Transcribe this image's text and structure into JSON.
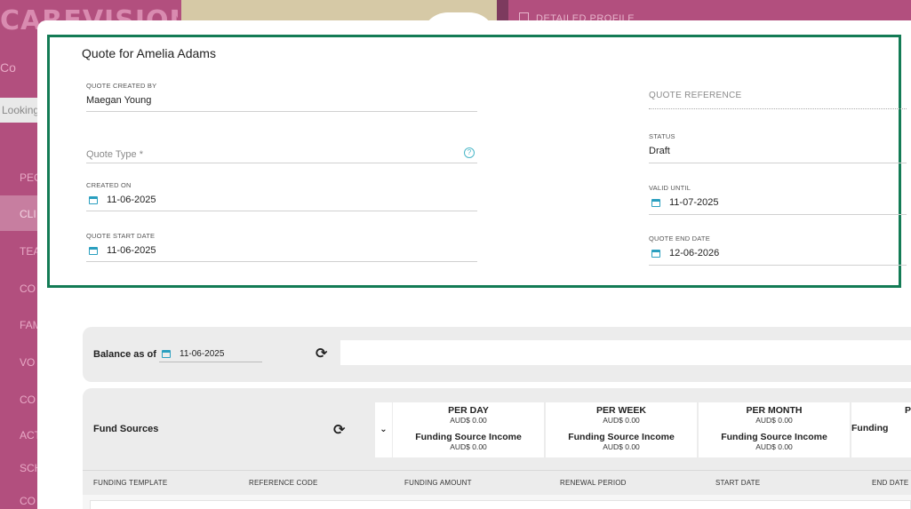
{
  "background": {
    "logo": "CAREVISION",
    "profile_tab": "DETAILED PROFILE",
    "search_placeholder": "Looking",
    "nav_items": [
      "Co",
      "PEO",
      "CLI",
      "TEA",
      "CO",
      "FAM",
      "VO",
      "CO",
      "ACT",
      "SCH",
      "CO"
    ]
  },
  "quote": {
    "title": "Quote for Amelia Adams",
    "created_by_label": "QUOTE CREATED BY",
    "created_by_value": "Maegan Young",
    "quote_type_placeholder": "Quote Type *",
    "created_on_label": "CREATED ON",
    "created_on_value": "11-06-2025",
    "start_date_label": "QUOTE START DATE",
    "start_date_value": "11-06-2025",
    "reference_placeholder": "QUOTE REFERENCE",
    "status_label": "STATUS",
    "status_value": "Draft",
    "valid_until_label": "VALID UNTIL",
    "valid_until_value": "11-07-2025",
    "end_date_label": "QUOTE END DATE",
    "end_date_value": "12-06-2026"
  },
  "balance": {
    "label": "Balance as of",
    "date": "11-06-2025"
  },
  "fund_sources": {
    "title": "Fund Sources",
    "periods": [
      {
        "heading": "PER DAY",
        "value": "AUD$ 0.00",
        "income_label": "Funding Source Income",
        "income_value": "AUD$ 0.00"
      },
      {
        "heading": "PER WEEK",
        "value": "AUD$ 0.00",
        "income_label": "Funding Source Income",
        "income_value": "AUD$ 0.00"
      },
      {
        "heading": "PER MONTH",
        "value": "AUD$ 0.00",
        "income_label": "Funding Source Income",
        "income_value": "AUD$ 0.00"
      },
      {
        "heading": "PE",
        "value": "",
        "income_label": "Funding",
        "income_value": ""
      }
    ],
    "columns": [
      "FUNDING TEMPLATE",
      "REFERENCE CODE",
      "FUNDING AMOUNT",
      "RENEWAL PERIOD",
      "START DATE",
      "END DATE"
    ]
  },
  "colors": {
    "accent": "#137b55",
    "brand": "#b24f7e",
    "icon": "#2a9fbf"
  }
}
